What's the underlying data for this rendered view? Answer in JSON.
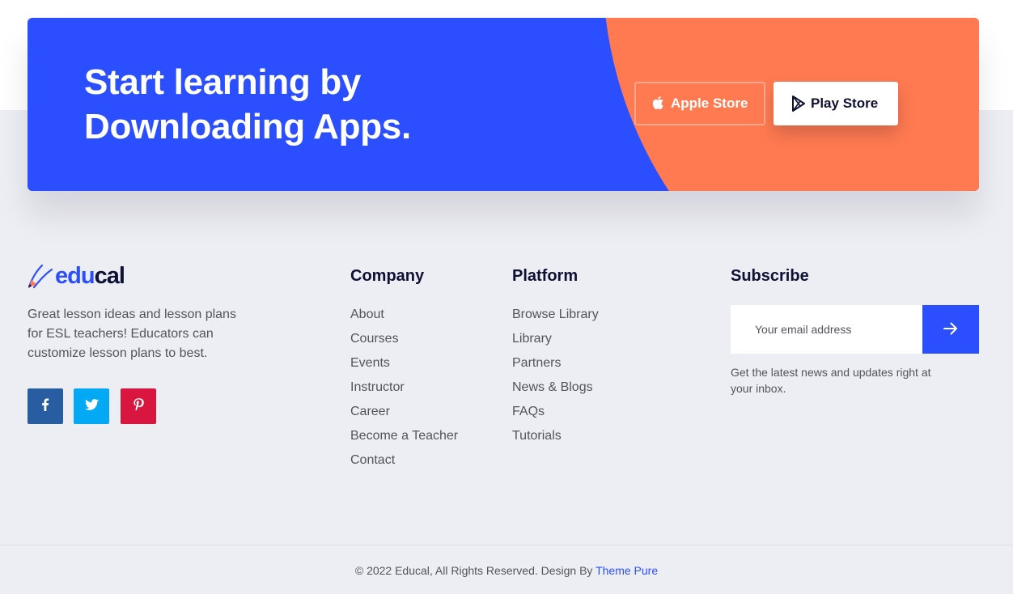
{
  "cta": {
    "title_line1": "Start learning by",
    "title_line2": "Downloading Apps.",
    "apple_label": "Apple Store",
    "play_label": "Play Store"
  },
  "brand": {
    "logo_edu": "edu",
    "logo_cal": "cal",
    "description": "Great lesson ideas and lesson plans for ESL teachers! Educators can customize lesson plans to best."
  },
  "social": [
    {
      "name": "facebook-icon",
      "glyph": "f"
    },
    {
      "name": "twitter-icon"
    },
    {
      "name": "pinterest-icon"
    }
  ],
  "company": {
    "title": "Company",
    "links": [
      "About",
      "Courses",
      "Events",
      "Instructor",
      "Career",
      "Become a Teacher",
      "Contact"
    ]
  },
  "platform": {
    "title": "Platform",
    "links": [
      "Browse Library",
      "Library",
      "Partners",
      "News & Blogs",
      "FAQs",
      "Tutorials"
    ]
  },
  "subscribe": {
    "title": "Subscribe",
    "placeholder": "Your email address",
    "note": "Get the latest news and updates right at your inbox."
  },
  "footer": {
    "copyright": "© 2022 Educal, All Rights Reserved. Design By",
    "author": "Theme Pure"
  },
  "colors": {
    "primary": "#2b4eff",
    "accent": "#ff7a51",
    "dark": "#0e1133",
    "background": "#edeef3"
  }
}
